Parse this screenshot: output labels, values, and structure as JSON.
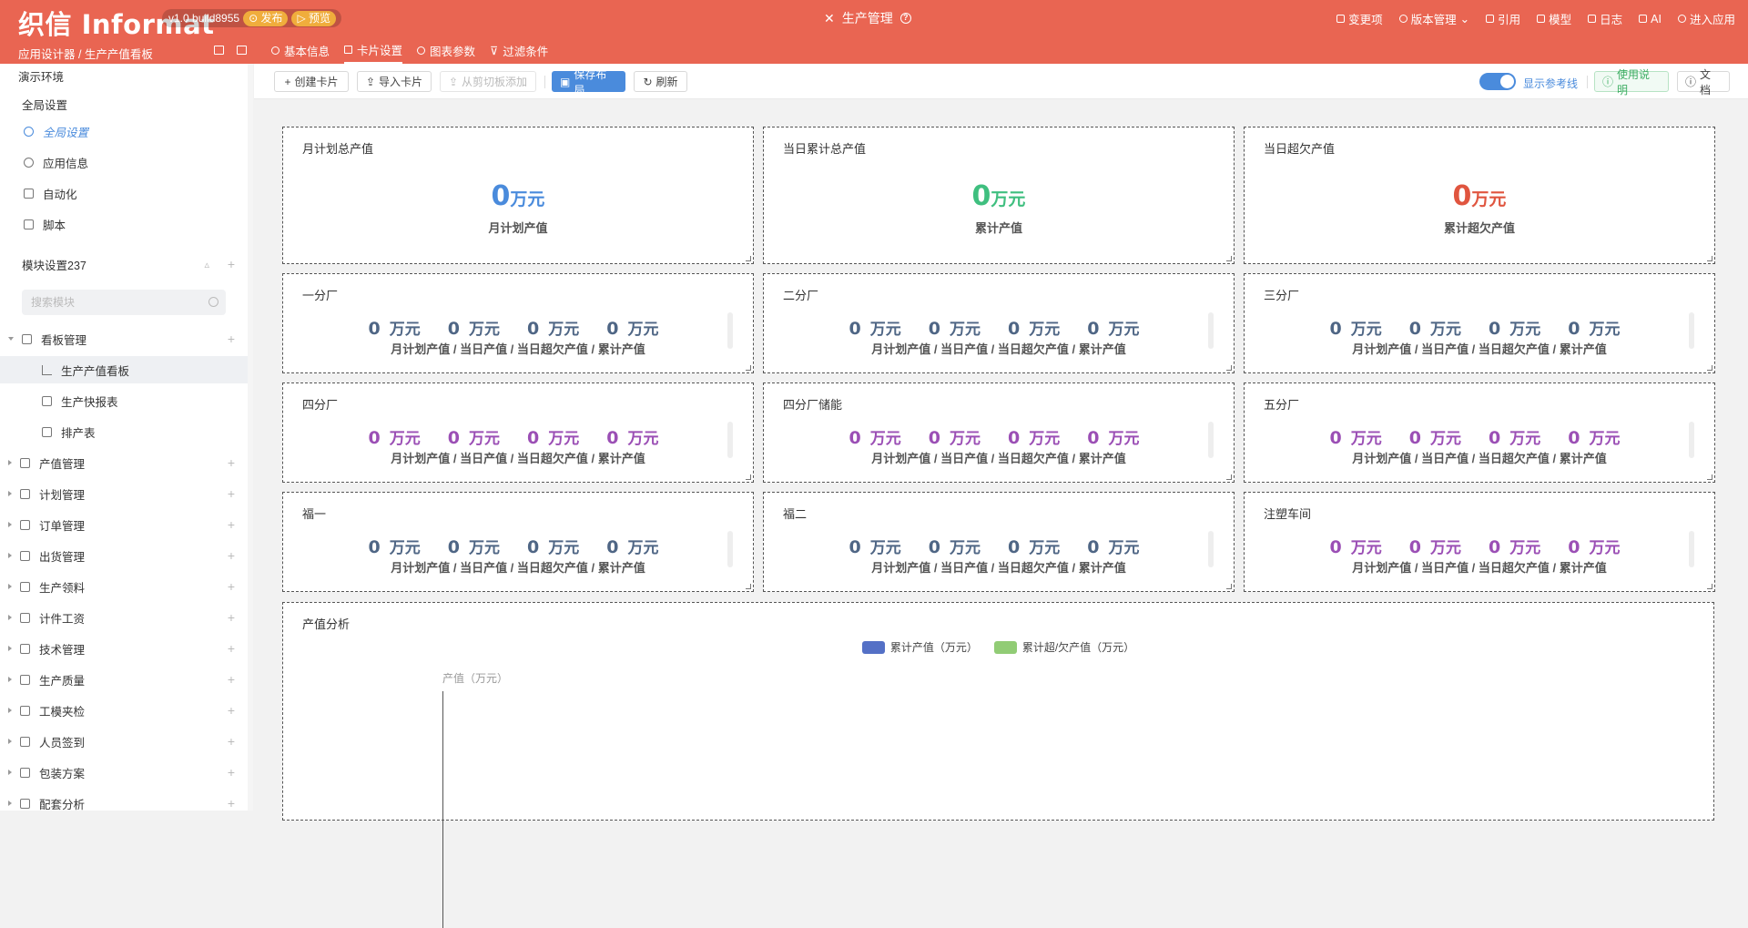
{
  "topbar": {
    "logo": "织信 Informat",
    "version": "v1.0 build8955",
    "publish": "发布",
    "preview": "预览",
    "app_title": "生产管理",
    "actions": [
      "变更项",
      "版本管理",
      "引用",
      "模型",
      "日志",
      "AI",
      "进入应用"
    ]
  },
  "subbar": {
    "breadcrumb": "应用设计器 / 生产产值看板",
    "tabs": [
      "基本信息",
      "卡片设置",
      "图表参数",
      "过滤条件"
    ],
    "active_tab": "卡片设置"
  },
  "sidebar": {
    "env": "演示环境",
    "global_header": "全局设置",
    "global_items": [
      "全局设置",
      "应用信息",
      "自动化",
      "脚本"
    ],
    "module_header": "模块设置237",
    "search_placeholder": "搜索模块",
    "board_group": "看板管理",
    "board_items": [
      "生产产值看板",
      "生产快报表",
      "排产表"
    ],
    "groups": [
      "产值管理",
      "计划管理",
      "订单管理",
      "出货管理",
      "生产领料",
      "计件工资",
      "技术管理",
      "生产质量",
      "工模夹检",
      "人员签到",
      "包装方案",
      "配套分析"
    ]
  },
  "toolbar": {
    "create_card": "创建卡片",
    "import_card": "导入卡片",
    "paste_add": "从剪切板添加",
    "save_layout": "保存布局",
    "refresh": "刷新",
    "show_ref": "显示参考线",
    "guide": "使用说明",
    "docs": "文档"
  },
  "colors": {
    "brand": "#e96552",
    "blue": "#4a8bdc",
    "green": "#3fbf7f",
    "red": "#e0553f",
    "slate": "#4f6685",
    "purple": "#9b4fb5"
  },
  "summary_cards": [
    {
      "title": "月计划总产值",
      "value": "0",
      "unit": "万元",
      "label": "月计划产值"
    },
    {
      "title": "当日累计总产值",
      "value": "0",
      "unit": "万元",
      "label": "累计产值"
    },
    {
      "title": "当日超欠产值",
      "value": "0",
      "unit": "万元",
      "label": "累计超欠产值"
    }
  ],
  "multi_label": "月计划产值 / 当日产值 / 当日超欠产值 / 累计产值",
  "multi_value": "0",
  "multi_unit": "万元",
  "factory_cards": [
    "一分厂",
    "二分厂",
    "三分厂",
    "四分厂",
    "四分厂储能",
    "五分厂",
    "福一",
    "福二",
    "注塑车间"
  ],
  "chart": {
    "title": "产值分析",
    "legend": [
      "累计产值（万元）",
      "累计超/欠产值（万元）"
    ],
    "legend_colors": [
      "#5470c6",
      "#91cc75"
    ],
    "yname": "产值（万元）"
  }
}
